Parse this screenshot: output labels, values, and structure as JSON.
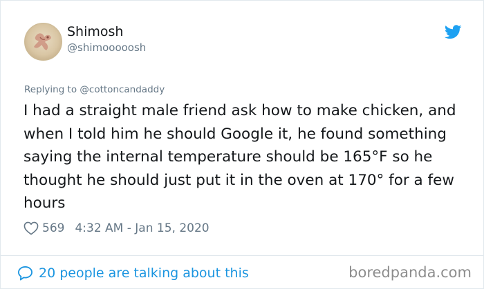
{
  "tweet": {
    "author": {
      "name": "Shimosh",
      "handle": "@shimooooosh",
      "avatar_icon": "avatar-illustration-icon"
    },
    "logo_icon": "twitter-bird-icon",
    "replying_to": "Replying to @cottoncandaddy",
    "text": "I had a straight male friend ask how to make chicken, and when I told him he should Google it, he found something saying the internal temperature should be 165°F so he thought he should just put it in the oven at 170° for a few hours",
    "likes": "569",
    "like_icon": "heart-outline-icon",
    "timestamp": "4:32 AM - Jan 15, 2020",
    "conversation_icon": "speech-bubble-icon",
    "conversation_label": "20 people are talking about this"
  },
  "watermark": "boredpanda.com",
  "colors": {
    "accent": "#1b95e0",
    "secondary_text": "#657786",
    "primary_text": "#14171a",
    "watermark": "#8d8d8d"
  }
}
